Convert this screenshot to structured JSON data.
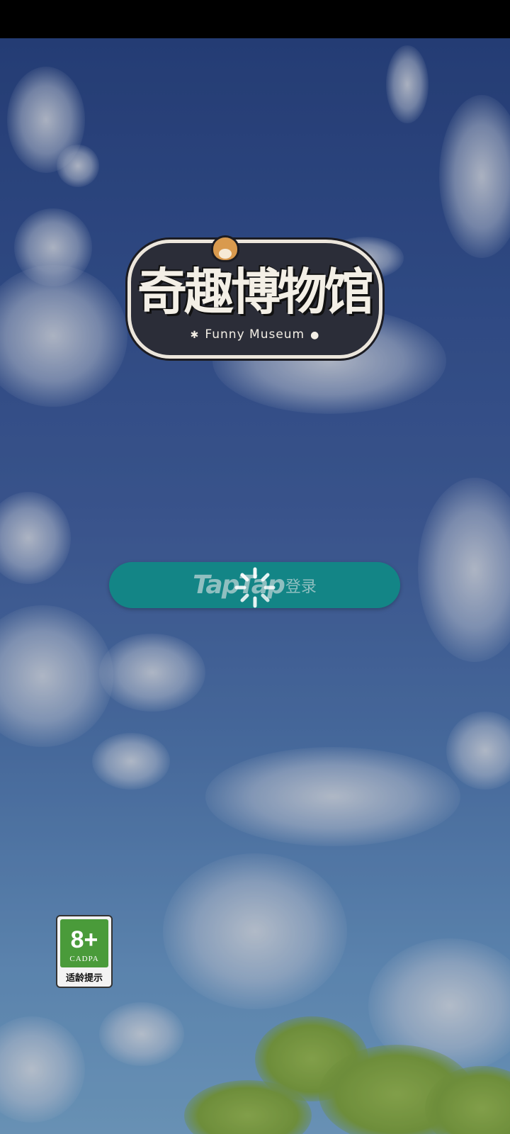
{
  "logo": {
    "title": "奇趣博物馆",
    "subtitle": "Funny Museum"
  },
  "login": {
    "brand": "TapTap",
    "label": "登录"
  },
  "age_rating": {
    "rating": "8+",
    "org": "CADPA",
    "note": "适龄提示",
    "color": "#4a9b3a"
  },
  "colors": {
    "button": "#138586",
    "sky_top": "#2d4a8e",
    "sky_bottom": "#7fb1dc"
  },
  "icons": {
    "spinner": "loading-spinner-icon"
  }
}
